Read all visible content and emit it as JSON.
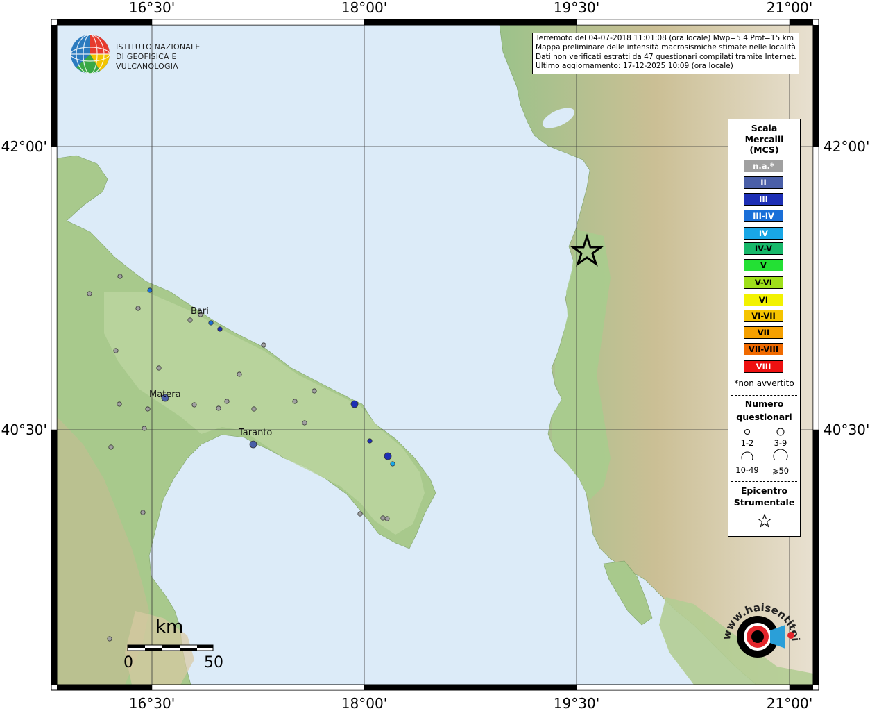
{
  "map": {
    "lon_ticks": [
      "16°30'",
      "18°00'",
      "19°30'",
      "21°00'"
    ],
    "lat_ticks": [
      "42°00'",
      "40°30'"
    ],
    "cities": [
      {
        "name": "Bari"
      },
      {
        "name": "Matera"
      },
      {
        "name": "Taranto"
      }
    ]
  },
  "info_box": {
    "line1": "Terremoto del 04-07-2018 11:01:08 (ora locale) Mwp=5.4 Prof=15 km",
    "line2": "Mappa preliminare delle intensità macrosismiche stimate nelle località",
    "line3": "Dati non verificati estratti da 47 questionari compilati tramite Internet.",
    "line4": "Ultimo aggiornamento: 17-12-2025 10:09 (ora locale)"
  },
  "ingv": {
    "line1": "ISTITUTO NAZIONALE",
    "line2": "DI GEOFISICA E VULCANOLOGIA"
  },
  "legend": {
    "title_line1": "Scala",
    "title_line2": "Mercalli",
    "title_line3": "(MCS)",
    "items": [
      {
        "label": "n.a.*",
        "color": "#a0a0a0"
      },
      {
        "label": "II",
        "color": "#4a5fa8"
      },
      {
        "label": "III",
        "color": "#1d2fb5"
      },
      {
        "label": "III-IV",
        "color": "#1a6fd8"
      },
      {
        "label": "IV",
        "color": "#19a7e6"
      },
      {
        "label": "IV-V",
        "color": "#17b86a"
      },
      {
        "label": "V",
        "color": "#23e034"
      },
      {
        "label": "V-VI",
        "color": "#9fe01a"
      },
      {
        "label": "VI",
        "color": "#f2f200"
      },
      {
        "label": "VI-VII",
        "color": "#f5c400"
      },
      {
        "label": "VII",
        "color": "#f5a000"
      },
      {
        "label": "VII-VIII",
        "color": "#f06a00"
      },
      {
        "label": "VIII",
        "color": "#ee1111"
      }
    ],
    "note": "*non avvertito",
    "count_title_line1": "Numero",
    "count_title_line2": "questionari",
    "size_labels": [
      "1-2",
      "3-9",
      "10-49",
      "⩾50"
    ],
    "epi_title_line1": "Epicentro",
    "epi_title_line2": "Strumentale"
  },
  "scale_bar": {
    "unit": "km",
    "start": "0",
    "end": "50"
  },
  "site_logo": {
    "text": "www.haisentitoilterremoto.it"
  }
}
